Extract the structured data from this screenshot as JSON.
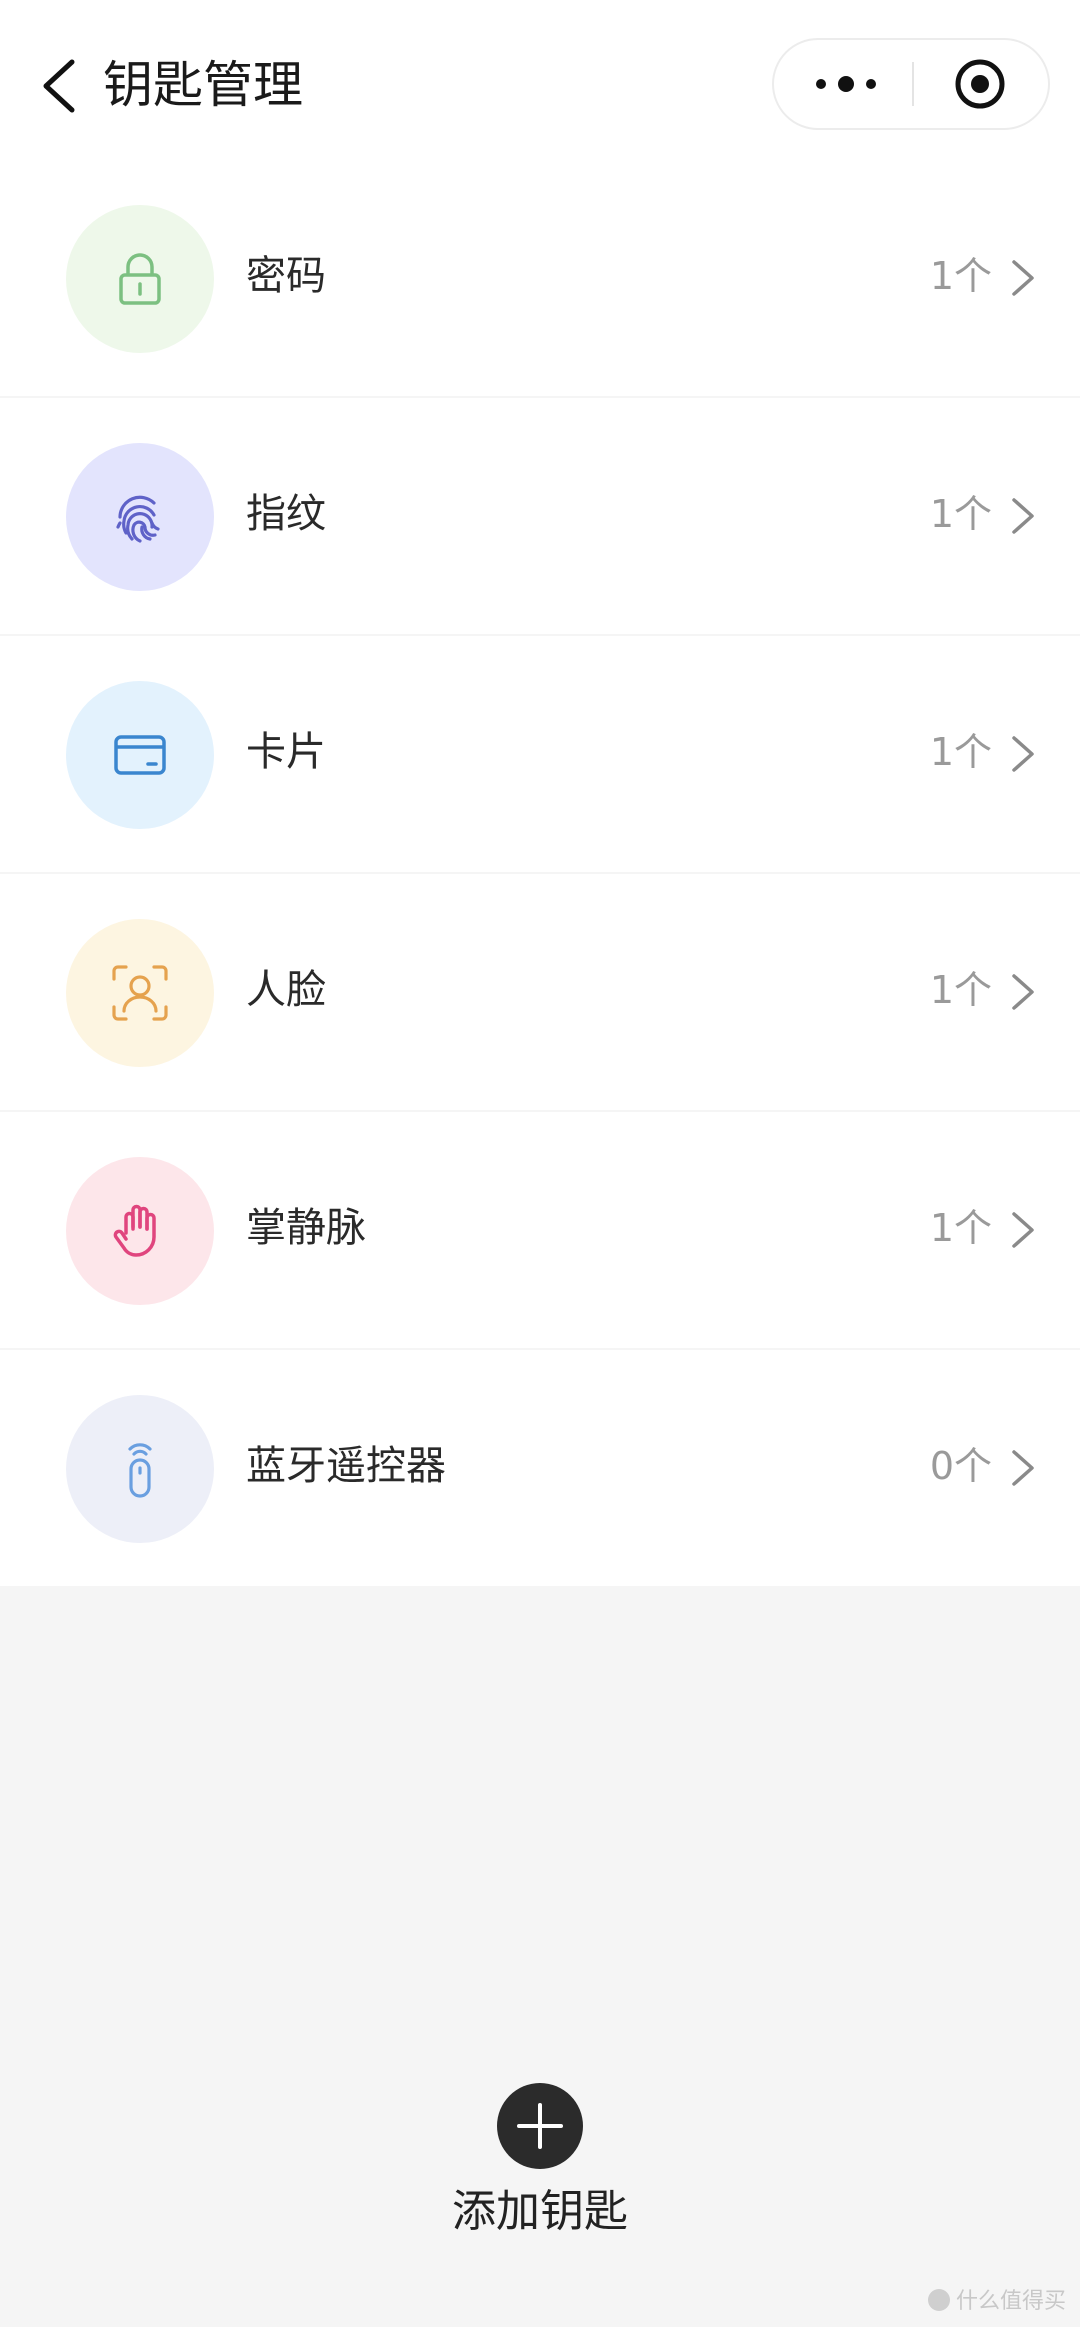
{
  "header": {
    "title": "钥匙管理",
    "back_icon": "chevron-left-icon",
    "more_icon": "more-dots-icon",
    "close_icon": "target-circle-icon"
  },
  "key_types": [
    {
      "label": "密码",
      "count": "1个",
      "icon": "lock-icon",
      "icon_color": "#7cc081",
      "bg_color": "#eef8ea"
    },
    {
      "label": "指纹",
      "count": "1个",
      "icon": "fingerprint-icon",
      "icon_color": "#5f62c8",
      "bg_color": "#e3e4fd"
    },
    {
      "label": "卡片",
      "count": "1个",
      "icon": "card-icon",
      "icon_color": "#3a86cf",
      "bg_color": "#e3f2fd"
    },
    {
      "label": "人脸",
      "count": "1个",
      "icon": "face-scan-icon",
      "icon_color": "#e5a24e",
      "bg_color": "#fdf5e1"
    },
    {
      "label": "掌静脉",
      "count": "1个",
      "icon": "palm-icon",
      "icon_color": "#e0457e",
      "bg_color": "#fde6ea"
    },
    {
      "label": "蓝牙遥控器",
      "count": "0个",
      "icon": "remote-control-icon",
      "icon_color": "#6a9fe0",
      "bg_color": "#edeff8"
    }
  ],
  "add_key": {
    "label": "添加钥匙",
    "icon": "plus-icon"
  },
  "watermark": {
    "text": "什么值得买"
  }
}
